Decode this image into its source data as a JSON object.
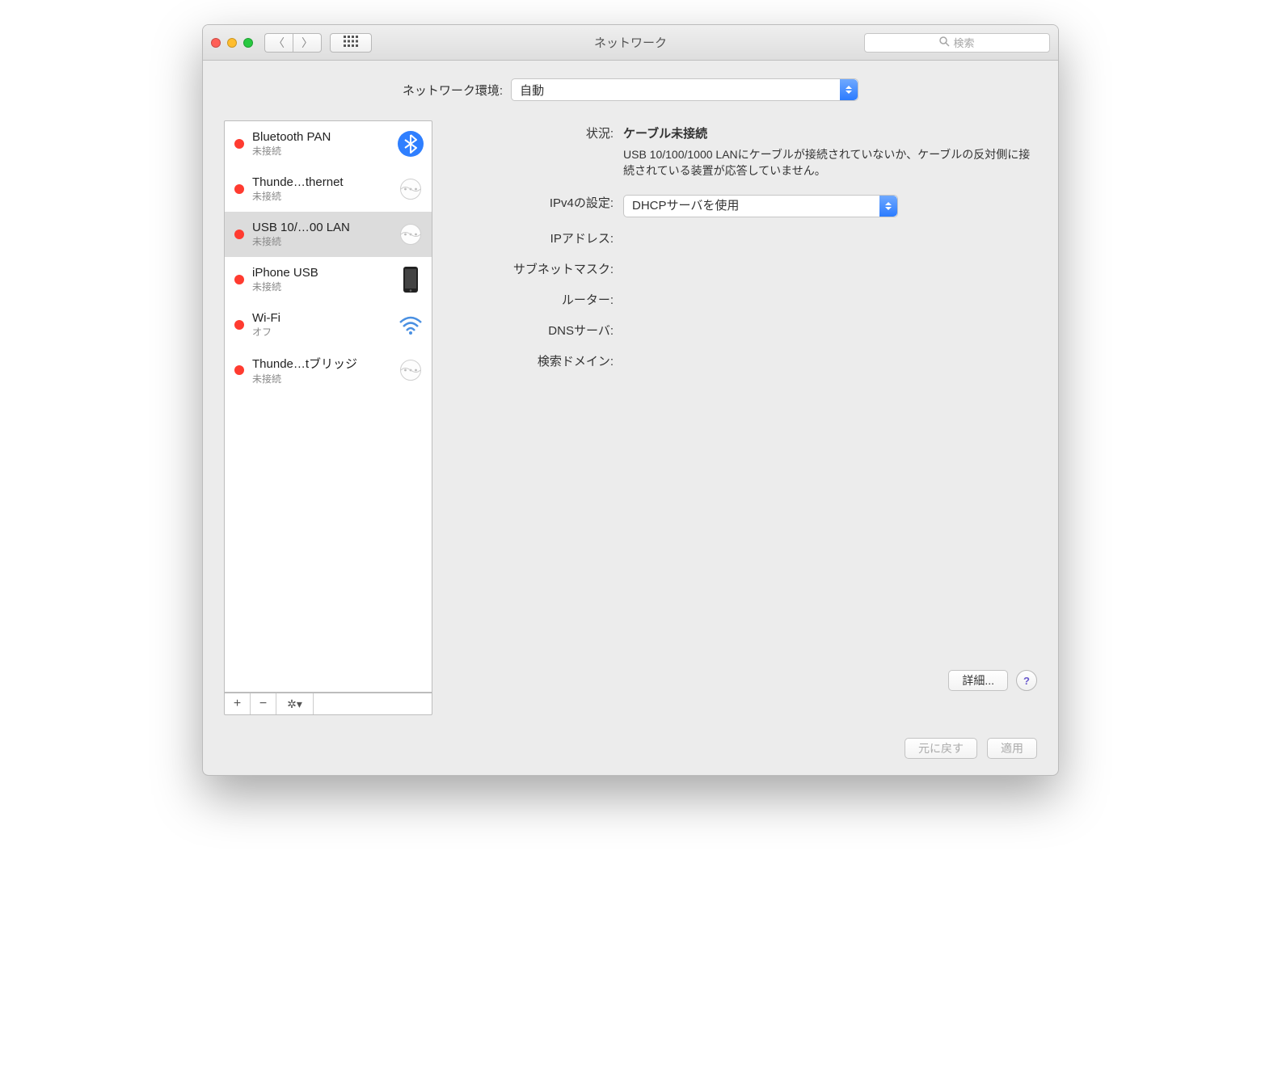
{
  "titlebar": {
    "title": "ネットワーク",
    "search_placeholder": "検索"
  },
  "location": {
    "label": "ネットワーク環境:",
    "value": "自動"
  },
  "sidebar": {
    "items": [
      {
        "name": "Bluetooth PAN",
        "status": "未接続",
        "icon": "bluetooth"
      },
      {
        "name": "Thunde…thernet",
        "status": "未接続",
        "icon": "ethernet"
      },
      {
        "name": "USB 10/…00 LAN",
        "status": "未接続",
        "icon": "ethernet",
        "selected": true
      },
      {
        "name": "iPhone USB",
        "status": "未接続",
        "icon": "phone"
      },
      {
        "name": "Wi-Fi",
        "status": "オフ",
        "icon": "wifi"
      },
      {
        "name": "Thunde…tブリッジ",
        "status": "未接続",
        "icon": "ethernet"
      }
    ],
    "toolbar": {
      "add": "+",
      "remove": "−",
      "gear": "✻▾"
    }
  },
  "detail": {
    "status_label": "状況:",
    "status_value": "ケーブル未接続",
    "status_desc": "USB 10/100/1000 LANにケーブルが接続されていないか、ケーブルの反対側に接続されている装置が応答していません。",
    "ipv4_label": "IPv4の設定:",
    "ipv4_value": "DHCPサーバを使用",
    "ip_label": "IPアドレス:",
    "ip_value": "",
    "subnet_label": "サブネットマスク:",
    "subnet_value": "",
    "router_label": "ルーター:",
    "router_value": "",
    "dns_label": "DNSサーバ:",
    "dns_value": "",
    "search_domain_label": "検索ドメイン:",
    "search_domain_value": "",
    "advanced_button": "詳細...",
    "help": "?"
  },
  "footer": {
    "revert": "元に戻す",
    "apply": "適用"
  }
}
